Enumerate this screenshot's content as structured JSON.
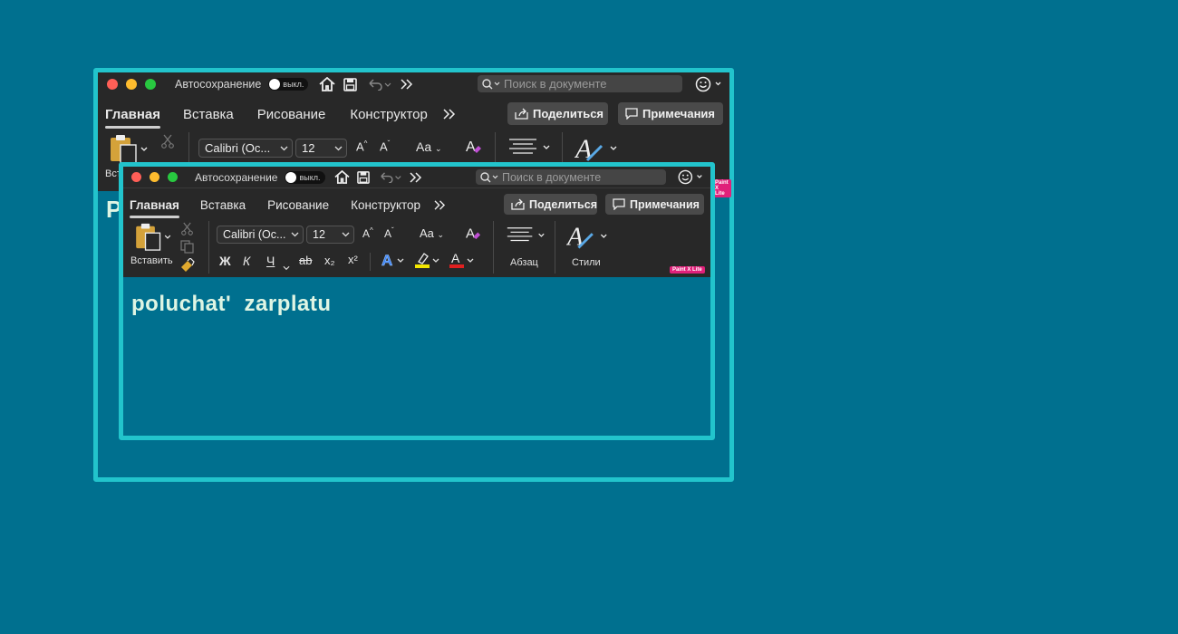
{
  "outer_window": {
    "autosave_label": "Автосохранение",
    "autosave_toggle": "выкл.",
    "search_placeholder": "Поиск в документе",
    "tabs": [
      "Главная",
      "Вставка",
      "Рисование",
      "Конструктор"
    ],
    "share_label": "Поделиться",
    "notes_label": "Примечания",
    "paste_label_partial": "Вст",
    "font_name": "Calibri (Ос...",
    "font_size": "12",
    "doc_text_partial": "P",
    "badge": "Paint X Lite"
  },
  "inner_window": {
    "autosave_label": "Автосохранение",
    "autosave_toggle": "выкл.",
    "search_placeholder": "Поиск в документе",
    "tabs": [
      "Главная",
      "Вставка",
      "Рисование",
      "Конструктор"
    ],
    "share_label": "Поделиться",
    "notes_label": "Примечания",
    "paste_label": "Вставить",
    "font_name": "Calibri (Ос...",
    "font_size": "12",
    "bold": "Ж",
    "italic": "К",
    "underline": "Ч",
    "strike": "ab",
    "subscript": "x₂",
    "superscript": "x²",
    "paragraph_label": "Абзац",
    "styles_label": "Стили",
    "badge": "Paint X Lite",
    "doc_text": "poluchat'  zarplatu"
  },
  "colors": {
    "background": "#00708f",
    "frame": "#22c4cc",
    "toolbar": "#282828",
    "highlight_yellow": "#f2e600",
    "font_red": "#e02020",
    "text_effect_blue": "#3b82f6"
  }
}
